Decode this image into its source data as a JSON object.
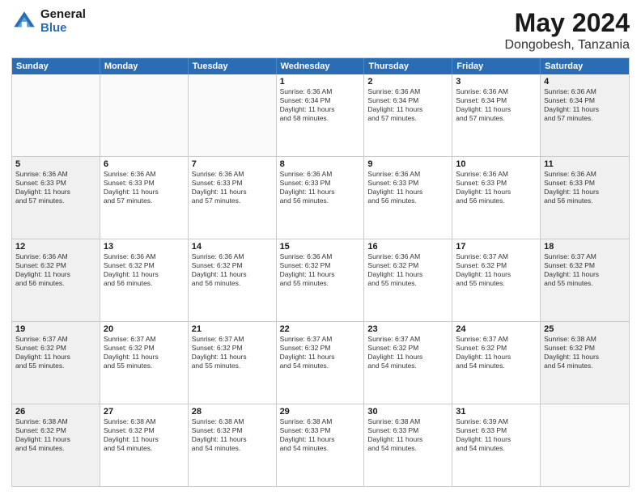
{
  "logo": {
    "general": "General",
    "blue": "Blue"
  },
  "title": "May 2024",
  "location": "Dongobesh, Tanzania",
  "days_of_week": [
    "Sunday",
    "Monday",
    "Tuesday",
    "Wednesday",
    "Thursday",
    "Friday",
    "Saturday"
  ],
  "weeks": [
    [
      {
        "day": "",
        "info": "",
        "empty": true
      },
      {
        "day": "",
        "info": "",
        "empty": true
      },
      {
        "day": "",
        "info": "",
        "empty": true
      },
      {
        "day": "1",
        "info": "Sunrise: 6:36 AM\nSunset: 6:34 PM\nDaylight: 11 hours\nand 58 minutes."
      },
      {
        "day": "2",
        "info": "Sunrise: 6:36 AM\nSunset: 6:34 PM\nDaylight: 11 hours\nand 57 minutes."
      },
      {
        "day": "3",
        "info": "Sunrise: 6:36 AM\nSunset: 6:34 PM\nDaylight: 11 hours\nand 57 minutes."
      },
      {
        "day": "4",
        "info": "Sunrise: 6:36 AM\nSunset: 6:34 PM\nDaylight: 11 hours\nand 57 minutes."
      }
    ],
    [
      {
        "day": "5",
        "info": "Sunrise: 6:36 AM\nSunset: 6:33 PM\nDaylight: 11 hours\nand 57 minutes."
      },
      {
        "day": "6",
        "info": "Sunrise: 6:36 AM\nSunset: 6:33 PM\nDaylight: 11 hours\nand 57 minutes."
      },
      {
        "day": "7",
        "info": "Sunrise: 6:36 AM\nSunset: 6:33 PM\nDaylight: 11 hours\nand 57 minutes."
      },
      {
        "day": "8",
        "info": "Sunrise: 6:36 AM\nSunset: 6:33 PM\nDaylight: 11 hours\nand 56 minutes."
      },
      {
        "day": "9",
        "info": "Sunrise: 6:36 AM\nSunset: 6:33 PM\nDaylight: 11 hours\nand 56 minutes."
      },
      {
        "day": "10",
        "info": "Sunrise: 6:36 AM\nSunset: 6:33 PM\nDaylight: 11 hours\nand 56 minutes."
      },
      {
        "day": "11",
        "info": "Sunrise: 6:36 AM\nSunset: 6:33 PM\nDaylight: 11 hours\nand 56 minutes."
      }
    ],
    [
      {
        "day": "12",
        "info": "Sunrise: 6:36 AM\nSunset: 6:32 PM\nDaylight: 11 hours\nand 56 minutes."
      },
      {
        "day": "13",
        "info": "Sunrise: 6:36 AM\nSunset: 6:32 PM\nDaylight: 11 hours\nand 56 minutes."
      },
      {
        "day": "14",
        "info": "Sunrise: 6:36 AM\nSunset: 6:32 PM\nDaylight: 11 hours\nand 56 minutes."
      },
      {
        "day": "15",
        "info": "Sunrise: 6:36 AM\nSunset: 6:32 PM\nDaylight: 11 hours\nand 55 minutes."
      },
      {
        "day": "16",
        "info": "Sunrise: 6:36 AM\nSunset: 6:32 PM\nDaylight: 11 hours\nand 55 minutes."
      },
      {
        "day": "17",
        "info": "Sunrise: 6:37 AM\nSunset: 6:32 PM\nDaylight: 11 hours\nand 55 minutes."
      },
      {
        "day": "18",
        "info": "Sunrise: 6:37 AM\nSunset: 6:32 PM\nDaylight: 11 hours\nand 55 minutes."
      }
    ],
    [
      {
        "day": "19",
        "info": "Sunrise: 6:37 AM\nSunset: 6:32 PM\nDaylight: 11 hours\nand 55 minutes."
      },
      {
        "day": "20",
        "info": "Sunrise: 6:37 AM\nSunset: 6:32 PM\nDaylight: 11 hours\nand 55 minutes."
      },
      {
        "day": "21",
        "info": "Sunrise: 6:37 AM\nSunset: 6:32 PM\nDaylight: 11 hours\nand 55 minutes."
      },
      {
        "day": "22",
        "info": "Sunrise: 6:37 AM\nSunset: 6:32 PM\nDaylight: 11 hours\nand 54 minutes."
      },
      {
        "day": "23",
        "info": "Sunrise: 6:37 AM\nSunset: 6:32 PM\nDaylight: 11 hours\nand 54 minutes."
      },
      {
        "day": "24",
        "info": "Sunrise: 6:37 AM\nSunset: 6:32 PM\nDaylight: 11 hours\nand 54 minutes."
      },
      {
        "day": "25",
        "info": "Sunrise: 6:38 AM\nSunset: 6:32 PM\nDaylight: 11 hours\nand 54 minutes."
      }
    ],
    [
      {
        "day": "26",
        "info": "Sunrise: 6:38 AM\nSunset: 6:32 PM\nDaylight: 11 hours\nand 54 minutes."
      },
      {
        "day": "27",
        "info": "Sunrise: 6:38 AM\nSunset: 6:32 PM\nDaylight: 11 hours\nand 54 minutes."
      },
      {
        "day": "28",
        "info": "Sunrise: 6:38 AM\nSunset: 6:32 PM\nDaylight: 11 hours\nand 54 minutes."
      },
      {
        "day": "29",
        "info": "Sunrise: 6:38 AM\nSunset: 6:33 PM\nDaylight: 11 hours\nand 54 minutes."
      },
      {
        "day": "30",
        "info": "Sunrise: 6:38 AM\nSunset: 6:33 PM\nDaylight: 11 hours\nand 54 minutes."
      },
      {
        "day": "31",
        "info": "Sunrise: 6:39 AM\nSunset: 6:33 PM\nDaylight: 11 hours\nand 54 minutes."
      },
      {
        "day": "",
        "info": "",
        "empty": true
      }
    ]
  ]
}
